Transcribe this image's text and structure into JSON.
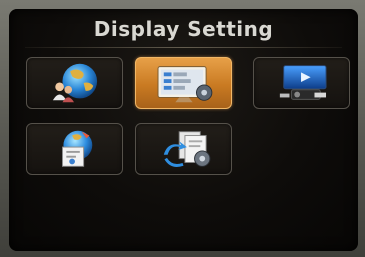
{
  "screen": {
    "title": "Display Setting"
  },
  "menu": {
    "selected_index": 1,
    "items": [
      {
        "icon": "globe-people-icon"
      },
      {
        "icon": "display-monitor-icon"
      },
      {
        "icon": "slideshow-projector-icon"
      },
      {
        "icon": "globe-document-icon"
      },
      {
        "icon": "document-gear-reset-icon"
      }
    ]
  },
  "colors": {
    "selected_tile": "#e7a048",
    "tile_border": "#55514a",
    "title_text": "#d9d8d2"
  }
}
